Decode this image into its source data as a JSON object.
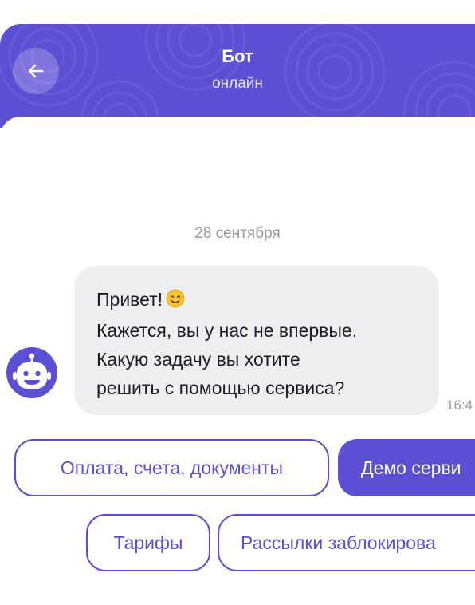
{
  "header": {
    "title": "Бот",
    "status": "онлайн",
    "accent_color": "#5b4fd3",
    "back_icon": "arrow-left-icon"
  },
  "chat": {
    "date_separator": "28 сентября",
    "message": {
      "lines": [
        "Привет!",
        "Кажется, вы у нас не впервые.",
        "Какую задачу вы хотите",
        "решить с помощью сервиса?"
      ],
      "emoji": "smiling-face-emoji",
      "time": "16:4"
    },
    "avatar_icon": "robot-icon"
  },
  "quick_replies": [
    {
      "label": "Оплата, счета, документы"
    },
    {
      "label": "Демо серви"
    },
    {
      "label": "Тарифы"
    },
    {
      "label": "Рассылки заблокирова"
    }
  ]
}
